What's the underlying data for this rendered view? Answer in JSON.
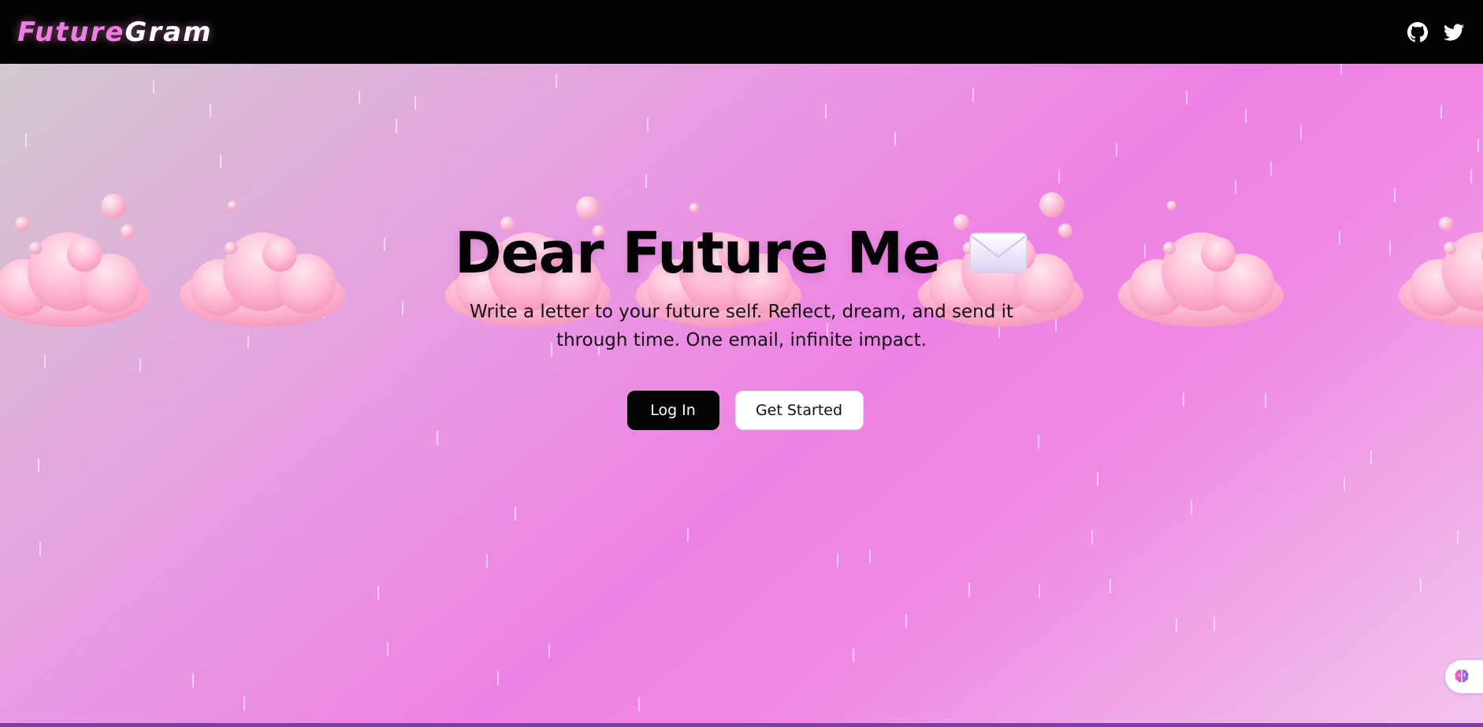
{
  "navbar": {
    "brand_part1": "Future",
    "brand_part2": "Gram",
    "icons": [
      "github-icon",
      "twitter-icon"
    ]
  },
  "hero": {
    "title": "Dear Future Me",
    "title_icon": "envelope-icon",
    "subtitle": "Write a letter to your future self. Reflect, dream, and send it through time. One email, infinite impact.",
    "buttons": {
      "login_label": "Log In",
      "get_started_label": "Get Started"
    }
  },
  "floating_widget": {
    "icon": "brain-icon"
  },
  "colors": {
    "navbar_bg": "#020202",
    "brand_accent": "#ee7fe0",
    "hero_gradient_mid": "#ee82e4",
    "cloud_pink": "#ffb0cc",
    "bottom_strip": "#7b3ea6"
  }
}
